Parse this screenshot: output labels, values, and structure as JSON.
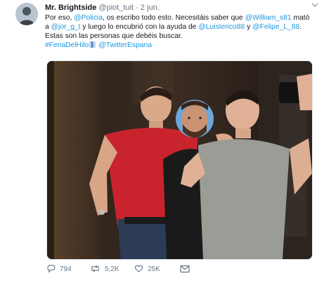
{
  "tweet": {
    "author_name": "Mr. Brightside",
    "handle": "@piot_tuit",
    "separator": "·",
    "date": "2 jun.",
    "text": {
      "l1_a": "Por eso, ",
      "l1_mention1": "@Policia",
      "l1_b": ", os escribo todo esto. Necesitáis saber que ",
      "l1_mention2": "@William_s81",
      "l1_c": " mató",
      "l2_a": "a ",
      "l2_mention1": "@jor_g_t",
      "l2_b": " y luego lo encubrió con la ayuda de ",
      "l2_mention2": "@Luisterico88",
      "l2_c": " y ",
      "l2_mention3": "@Felipe_L_88",
      "l2_d": ".",
      "l3": "Estas son las personas que debéis buscar.",
      "l4_hashtag": "#FeriaDelHilo",
      "l4_mention": "@TwitterEspana"
    },
    "stats": {
      "replies": "794",
      "retweets": "5,2K",
      "likes": "25K"
    },
    "icons": {
      "reply": "reply-icon",
      "retweet": "retweet-icon",
      "like": "heart-icon",
      "dm": "envelope-icon",
      "more": "chevron-down-icon",
      "emoji": "flag-emoji-icon"
    },
    "colors": {
      "link": "#1b95e0",
      "muted": "#657786",
      "text": "#14171a"
    }
  }
}
